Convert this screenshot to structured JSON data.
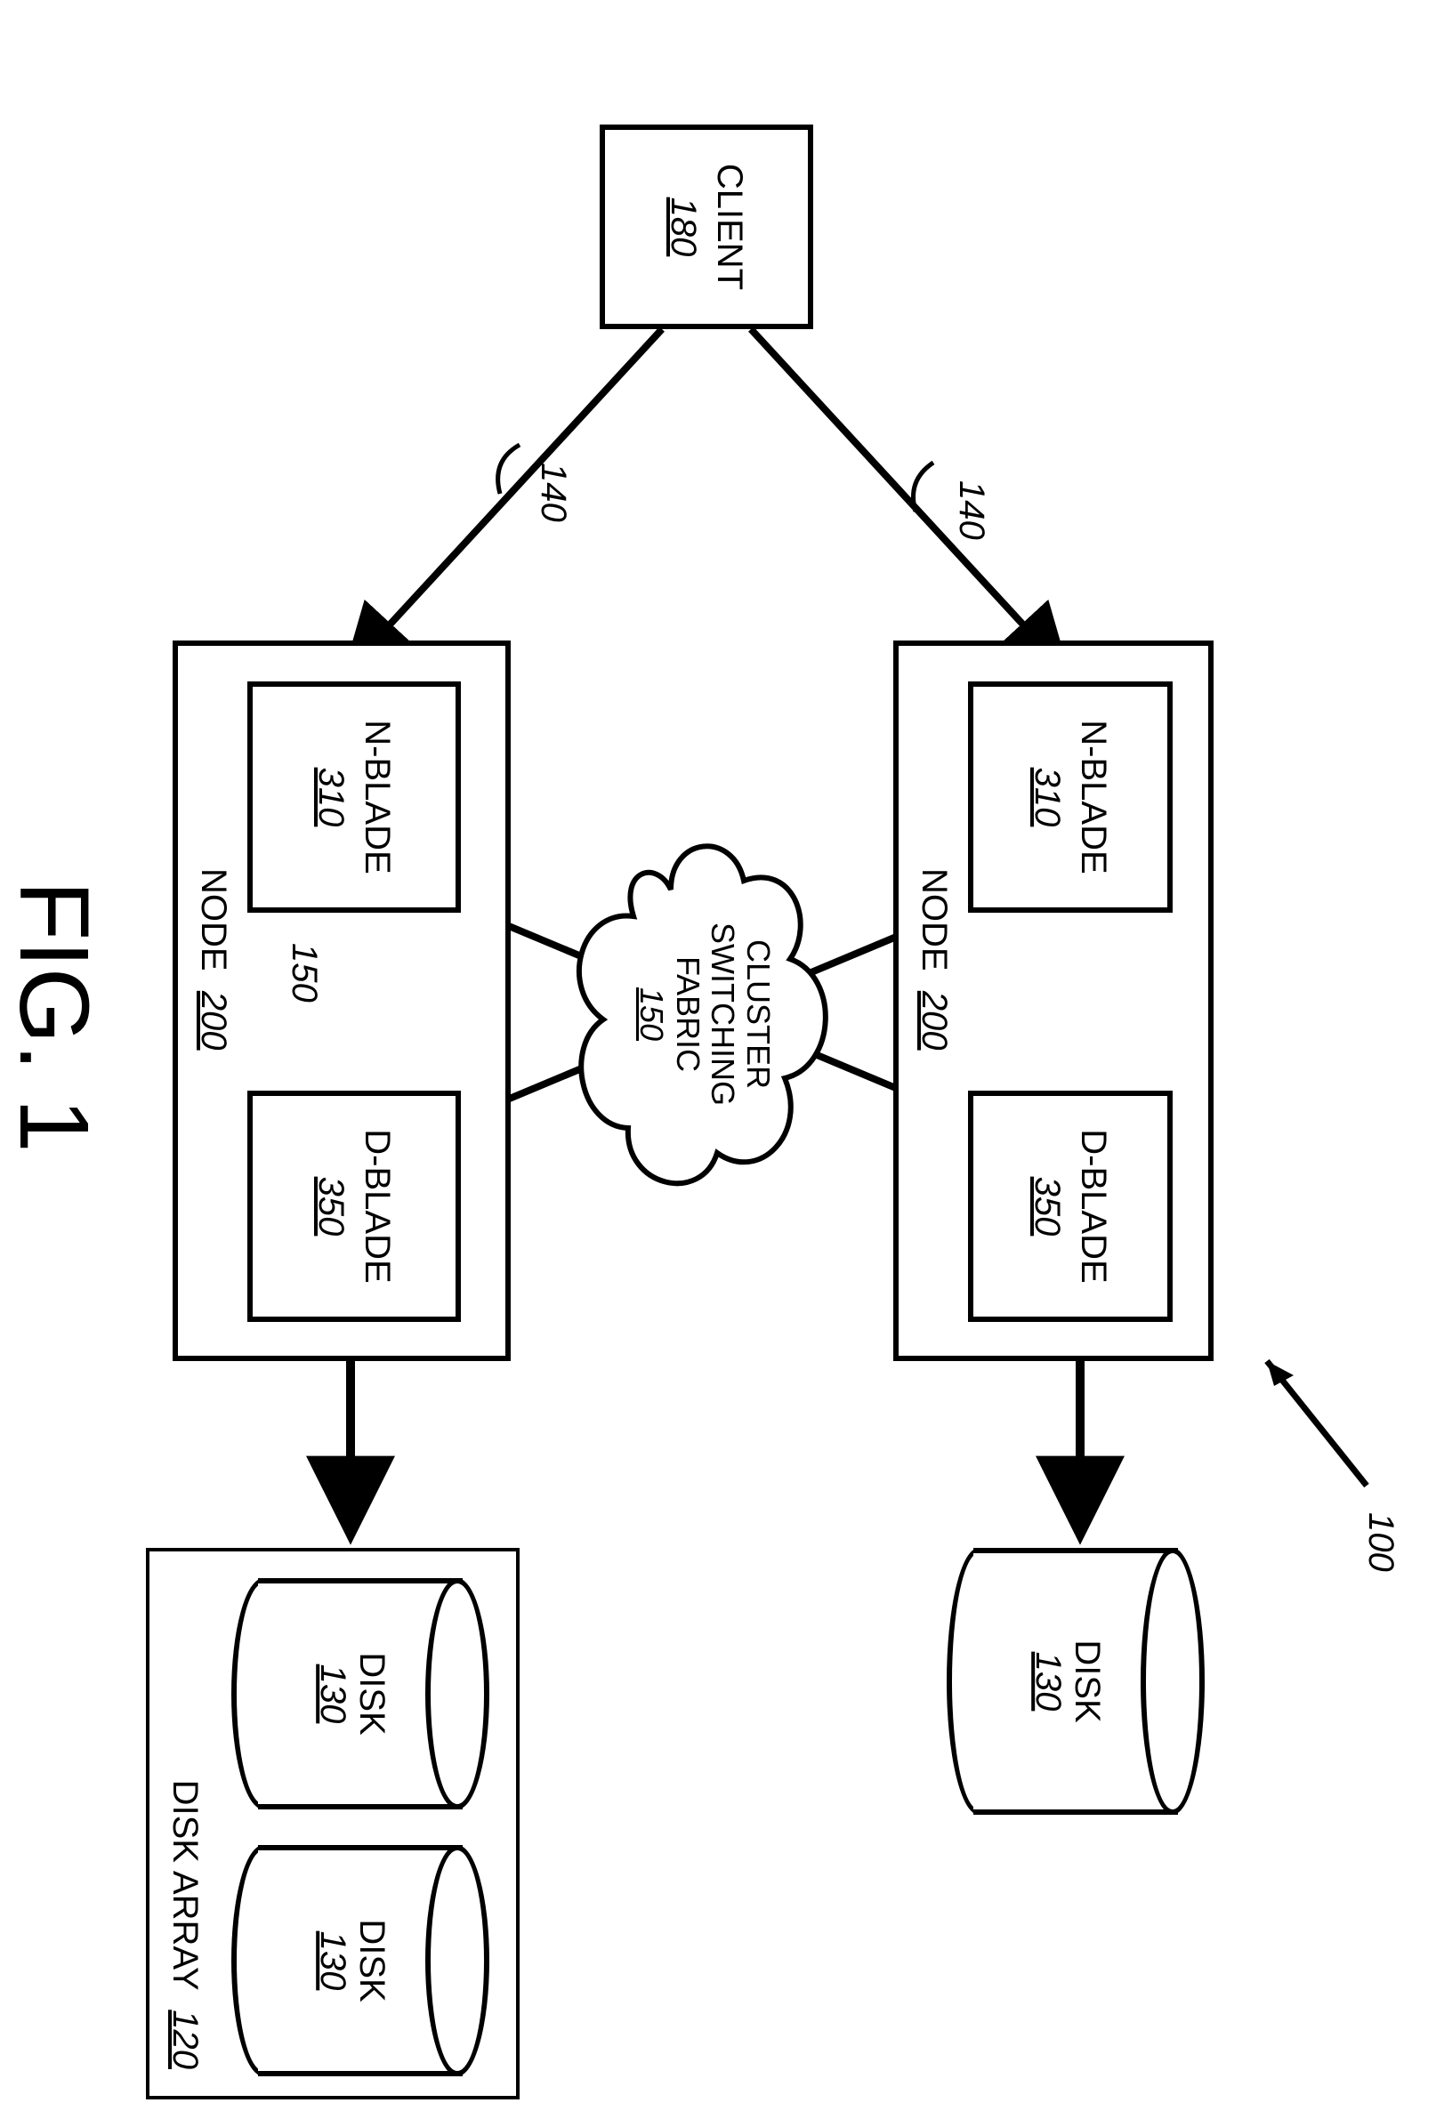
{
  "figure": {
    "caption": "FIG. 1",
    "system_ref": "100"
  },
  "client": {
    "label": "CLIENT",
    "ref": "180"
  },
  "links": {
    "client_to_node": "140",
    "fabric_to_node": "150"
  },
  "fabric": {
    "line1": "CLUSTER",
    "line2": "SWITCHING",
    "line3": "FABRIC",
    "ref": "150"
  },
  "nodes": [
    {
      "container_label": "NODE",
      "container_ref": "200",
      "nblade": {
        "label": "N-BLADE",
        "ref": "310"
      },
      "dblade": {
        "label": "D-BLADE",
        "ref": "350"
      }
    },
    {
      "container_label": "NODE",
      "container_ref": "200",
      "nblade": {
        "label": "N-BLADE",
        "ref": "310"
      },
      "dblade": {
        "label": "D-BLADE",
        "ref": "350"
      }
    }
  ],
  "disks": {
    "single": {
      "label": "DISK",
      "ref": "130"
    },
    "array": {
      "label": "DISK ARRAY",
      "ref": "120",
      "items": [
        {
          "label": "DISK",
          "ref": "130"
        },
        {
          "label": "DISK",
          "ref": "130"
        }
      ]
    }
  }
}
